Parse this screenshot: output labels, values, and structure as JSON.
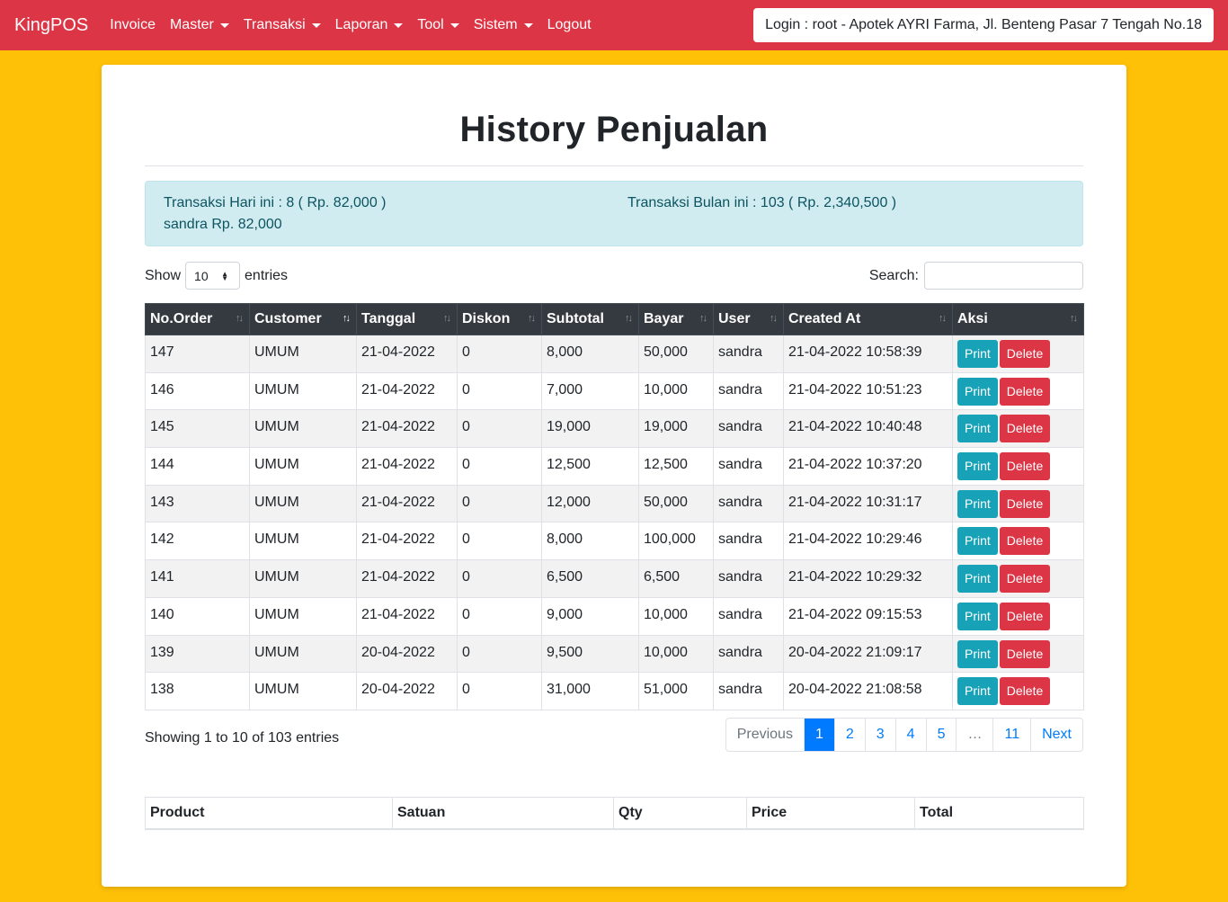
{
  "navbar": {
    "brand": "KingPOS",
    "items": [
      {
        "label": "Invoice",
        "dropdown": false
      },
      {
        "label": "Master",
        "dropdown": true
      },
      {
        "label": "Transaksi",
        "dropdown": true
      },
      {
        "label": "Laporan",
        "dropdown": true
      },
      {
        "label": "Tool",
        "dropdown": true
      },
      {
        "label": "Sistem",
        "dropdown": true
      },
      {
        "label": "Logout",
        "dropdown": false
      }
    ],
    "login_info": "Login : root - Apotek AYRI Farma, Jl. Benteng Pasar 7 Tengah No.18"
  },
  "page": {
    "title": "History Penjualan"
  },
  "summary": {
    "today": "Transaksi Hari ini : 8 ( Rp. 82,000 )",
    "month": "Transaksi Bulan ini : 103 ( Rp. 2,340,500 )",
    "user": "sandra Rp. 82,000"
  },
  "controls": {
    "show_label": "Show",
    "entries_value": "10",
    "entries_label": "entries",
    "search_label": "Search:",
    "search_value": ""
  },
  "table": {
    "columns": [
      "No.Order",
      "Customer",
      "Tanggal",
      "Diskon",
      "Subtotal",
      "Bayar",
      "User",
      "Created At",
      "Aksi"
    ],
    "print_label": "Print",
    "delete_label": "Delete",
    "rows": [
      [
        "147",
        "UMUM",
        "21-04-2022",
        "0",
        "8,000",
        "50,000",
        "sandra",
        "21-04-2022 10:58:39"
      ],
      [
        "146",
        "UMUM",
        "21-04-2022",
        "0",
        "7,000",
        "10,000",
        "sandra",
        "21-04-2022 10:51:23"
      ],
      [
        "145",
        "UMUM",
        "21-04-2022",
        "0",
        "19,000",
        "19,000",
        "sandra",
        "21-04-2022 10:40:48"
      ],
      [
        "144",
        "UMUM",
        "21-04-2022",
        "0",
        "12,500",
        "12,500",
        "sandra",
        "21-04-2022 10:37:20"
      ],
      [
        "143",
        "UMUM",
        "21-04-2022",
        "0",
        "12,000",
        "50,000",
        "sandra",
        "21-04-2022 10:31:17"
      ],
      [
        "142",
        "UMUM",
        "21-04-2022",
        "0",
        "8,000",
        "100,000",
        "sandra",
        "21-04-2022 10:29:46"
      ],
      [
        "141",
        "UMUM",
        "21-04-2022",
        "0",
        "6,500",
        "6,500",
        "sandra",
        "21-04-2022 10:29:32"
      ],
      [
        "140",
        "UMUM",
        "21-04-2022",
        "0",
        "9,000",
        "10,000",
        "sandra",
        "21-04-2022 09:15:53"
      ],
      [
        "139",
        "UMUM",
        "20-04-2022",
        "0",
        "9,500",
        "10,000",
        "sandra",
        "20-04-2022 21:09:17"
      ],
      [
        "138",
        "UMUM",
        "20-04-2022",
        "0",
        "31,000",
        "51,000",
        "sandra",
        "20-04-2022 21:08:58"
      ]
    ]
  },
  "footer": {
    "showing": "Showing 1 to 10 of 103 entries",
    "pagination": [
      "Previous",
      "1",
      "2",
      "3",
      "4",
      "5",
      "…",
      "11",
      "Next"
    ],
    "active_page": "1"
  },
  "detail_table": {
    "columns": [
      "Product",
      "Satuan",
      "Qty",
      "Price",
      "Total"
    ]
  },
  "colors": {
    "navbar": "#dc3545",
    "background": "#ffc107",
    "print_button": "#17a2b8",
    "delete_button": "#dc3545",
    "active_page": "#007bff"
  }
}
